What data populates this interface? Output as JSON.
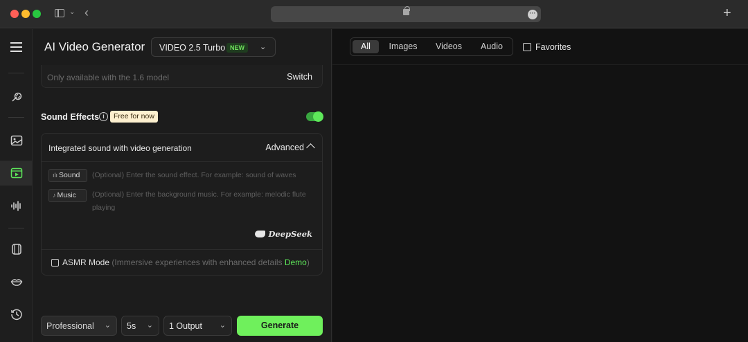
{
  "browser": {
    "traffic_lights": [
      "#ff5f57",
      "#febc2e",
      "#28c840"
    ],
    "icons": [
      "sidebar-toggle-icon",
      "chevron-down-icon",
      "back-arrow-icon",
      "lock-icon",
      "more-icon",
      "new-tab-icon"
    ]
  },
  "rail": {
    "items": [
      {
        "name": "menu-icon"
      },
      {
        "name": "magic-brush-icon"
      },
      {
        "name": "image-icon"
      },
      {
        "name": "video-icon",
        "active": true
      },
      {
        "name": "audio-wave-icon"
      },
      {
        "name": "cube-icon"
      },
      {
        "name": "lips-icon"
      },
      {
        "name": "history-icon"
      }
    ],
    "accent": "#5ee85a"
  },
  "header": {
    "title": "AI Video Generator",
    "model": "VIDEO 2.5 Turbo",
    "model_badge": "NEW"
  },
  "notice": {
    "text": "Only available with the 1.6 model",
    "action": "Switch"
  },
  "sound_effects": {
    "label": "Sound Effects",
    "badge": "Free for now",
    "enabled": true,
    "card_title": "Integrated sound with video generation",
    "advanced_label": "Advanced",
    "sound_chip": "Sound",
    "sound_placeholder": "(Optional) Enter the sound effect. For example: sound of waves",
    "music_chip": "Music",
    "music_placeholder": "(Optional) Enter the background music. For example: melodic flute playing",
    "brand": "DeepSeek",
    "asmr_label": "ASMR Mode",
    "asmr_desc": "(Immersive experiences with enhanced details",
    "asmr_demo": "Demo",
    "asmr_close": ")"
  },
  "bottom": {
    "mode": "Professional",
    "duration": "5s",
    "outputs": "1 Output",
    "generate": "Generate"
  },
  "gallery": {
    "filters": [
      "All",
      "Images",
      "Videos",
      "Audio"
    ],
    "active_filter": "All",
    "favorites": "Favorites"
  }
}
